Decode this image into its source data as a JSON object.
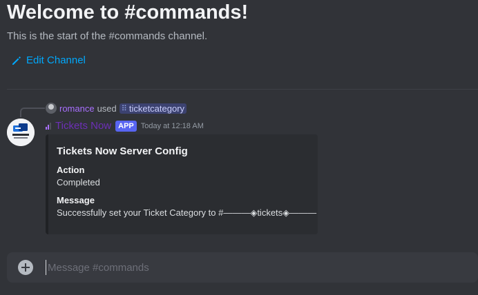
{
  "channel_header": {
    "title": "Welcome to #commands!",
    "subtitle": "This is the start of the #commands channel.",
    "edit_label": "Edit Channel"
  },
  "reply": {
    "username": "romance",
    "used_text": "used",
    "command": "ticketcategory",
    "command_icon": "slash-command-icon"
  },
  "message": {
    "bot_name": "Tickets Now",
    "app_tag": "APP",
    "timestamp": "Today at 12:18 AM",
    "bot_name_color": "#6d2fb7"
  },
  "embed": {
    "title": "Tickets Now Server Config",
    "fields": [
      {
        "name": "Action",
        "value": "Completed"
      },
      {
        "name": "Message",
        "value": "Successfully set your Ticket Category to #———◈tickets◈———"
      }
    ]
  },
  "composer": {
    "placeholder": "Message #commands"
  },
  "colors": {
    "background": "#313338",
    "link": "#00a8fc",
    "app_tag": "#5865f2",
    "embed_bg": "#2b2d31"
  }
}
